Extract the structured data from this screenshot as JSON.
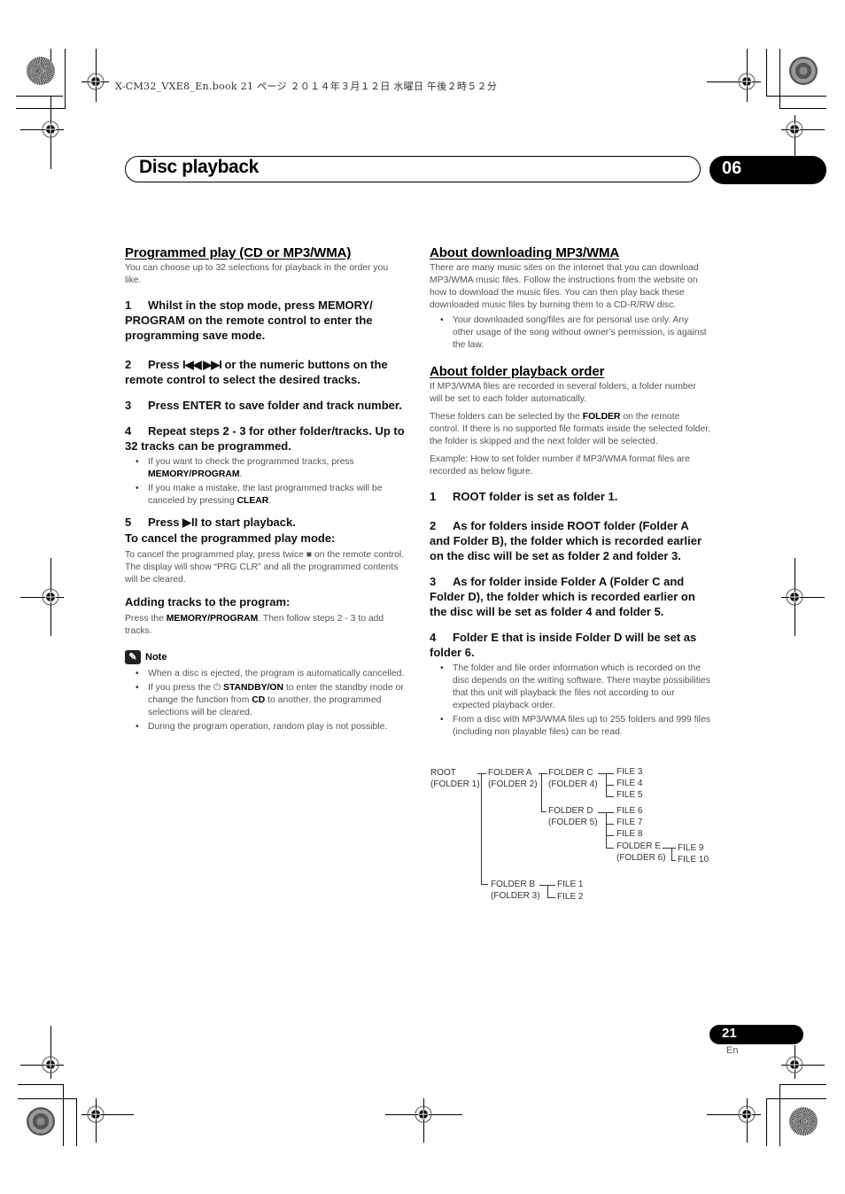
{
  "print_slug": "X-CM32_VXE8_En.book  21 ページ  ２０１４年３月１２日  水曜日  午後２時５２分",
  "header": {
    "title": "Disc playback",
    "chapter": "06"
  },
  "left": {
    "title": "Programmed play (CD or MP3/WMA)",
    "intro": "You can choose up to 32 selections for playback in the order you like.",
    "steps": [
      {
        "n": "1",
        "text": "Whilst in the stop mode, press MEMORY/ PROGRAM on the remote control to enter the programming save mode."
      },
      {
        "n": "2",
        "text": "Press ⏮◀◀ ▶▶⏭ or the numeric buttons on the remote control to select the desired tracks."
      },
      {
        "n": "3",
        "text": "Press ENTER to save folder and track number."
      },
      {
        "n": "4",
        "text": "Repeat steps 2 - 3 for other folder/tracks. Up to 32 tracks can be programmed."
      },
      {
        "n": "5",
        "text": "Press ▶II to start playback."
      }
    ],
    "step2_pre": "Press ",
    "step2_icon": "I◀◀ ▶▶I",
    "step2_post": " or the numeric buttons on the remote control to select the desired tracks.",
    "step4_bullets": [
      {
        "pre": "If you want to check the programmed tracks, press ",
        "bold": "MEMORY/PROGRAM",
        "post": "."
      },
      {
        "pre": "If you make a mistake, the last programmed tracks will be canceled by pressing ",
        "bold": "CLEAR",
        "post": "."
      }
    ],
    "step5_pre": "Press ",
    "step5_icon": "▶II",
    "step5_post": " to start playback.",
    "cancel_title": "To cancel the programmed play mode:",
    "cancel_text": "To cancel the programmed play, press twice ■ on the remote control. The display will show “PRG CLR” and all the programmed contents will be cleared.",
    "adding_title": "Adding tracks to the program:",
    "adding_pre": "Press the ",
    "adding_bold": "MEMORY/PROGRAM",
    "adding_post": ". Then follow steps 2 - 3 to add tracks.",
    "note_label": "Note",
    "note_bullets": [
      {
        "pre": "When a disc is ejected, the program is automatically cancelled.",
        "bold": "",
        "post": ""
      },
      {
        "pre": "If you press the ⏻ ",
        "bold": "STANDBY/ON",
        "post": " to enter the standby mode or change the function from ",
        "bold2": "CD",
        "post2": " to another, the programmed selections will be cleared."
      },
      {
        "pre": "During the program operation, random play is not possible.",
        "bold": "",
        "post": ""
      }
    ]
  },
  "right": {
    "dl_title": "About downloading MP3/WMA",
    "dl_text": "There are many music sites on the internet that you can download MP3/WMA music files. Follow the instructions from the website on how to download the music files. You can then play back these downloaded music files by burning them to a CD-R/RW disc.",
    "dl_bullet": "Your downloaded song/files are for personal use only. Any other usage of the song without owner’s permission, is against the law.",
    "order_title": "About folder playback order",
    "order_p1": "If MP3/WMA files are recorded in several folders, a folder number will be set to each folder automatically.",
    "order_p2_pre": "These folders can be selected by the ",
    "order_p2_bold": "FOLDER",
    "order_p2_post": " on the remote control. If there is no supported file formats inside the selected folder, the folder is skipped and the next folder will be selected.",
    "order_p3": "Example: How to set folder number if MP3/WMA format files are recorded as below figure.",
    "steps": [
      {
        "n": "1",
        "text": "ROOT folder is set as folder 1."
      },
      {
        "n": "2",
        "text": "As for folders inside ROOT folder (Folder A and Folder B), the folder which is recorded earlier on the disc will be set as folder 2 and folder 3."
      },
      {
        "n": "3",
        "text": "As for folder inside Folder A (Folder C and Folder D), the folder which is recorded earlier on the disc will be set as folder 4 and folder 5."
      },
      {
        "n": "4",
        "text": "Folder E that is inside Folder D will be set as folder 6."
      }
    ],
    "bullets": [
      "The folder and file order information which is recorded on the disc depends on the writing software. There maybe possibilities that this unit will playback the files not according to our expected playback order.",
      "From a disc with MP3/WMA files up to 255 folders and 999 files (including non playable files) can be read."
    ],
    "tree": {
      "root": [
        "ROOT",
        "(FOLDER 1)"
      ],
      "folder_a": [
        "FOLDER A",
        "(FOLDER 2)"
      ],
      "folder_b": [
        "FOLDER B",
        "(FOLDER 3)"
      ],
      "folder_c": [
        "FOLDER C",
        "(FOLDER 4)"
      ],
      "folder_d": [
        "FOLDER D",
        "(FOLDER 5)"
      ],
      "folder_e": [
        "FOLDER E",
        "(FOLDER 6)"
      ],
      "files": [
        "FILE 1",
        "FILE 2",
        "FILE 3",
        "FILE 4",
        "FILE 5",
        "FILE 6",
        "FILE 7",
        "FILE 8",
        "FILE 9",
        "FILE 10"
      ]
    }
  },
  "footer": {
    "page": "21",
    "lang": "En"
  }
}
